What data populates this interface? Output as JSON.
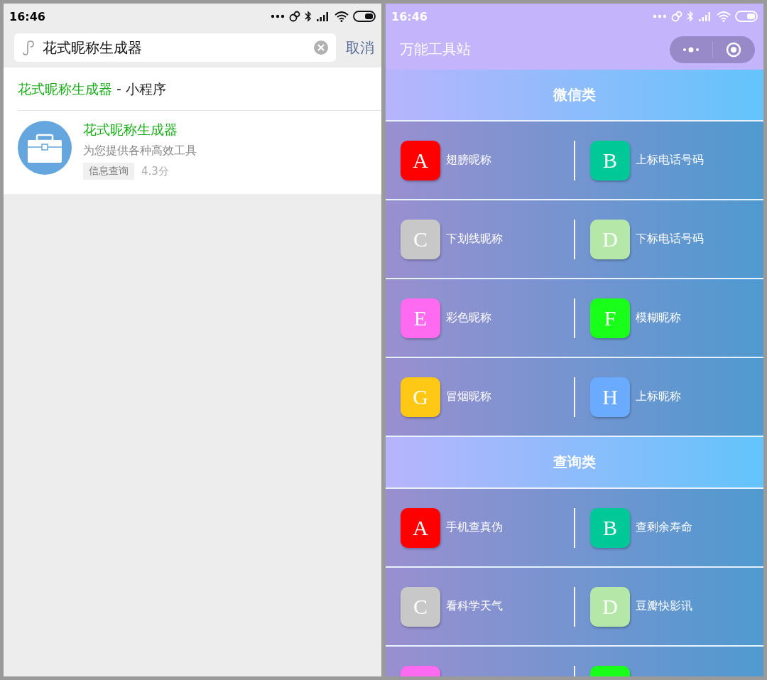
{
  "left_screen": {
    "status_bar": {
      "time": "16:46"
    },
    "search": {
      "value": "花式昵称生成器",
      "cancel": "取消"
    },
    "results": {
      "heading": {
        "match": "花式昵称生成器",
        "rest": " - 小程序"
      },
      "items": [
        {
          "name": "花式昵称生成器",
          "description": "为您提供各种高效工具",
          "tag": "信息查询",
          "rating": "4.3分"
        }
      ]
    }
  },
  "right_screen": {
    "status_bar": {
      "time": "16:46"
    },
    "nav_bar": {
      "title": "万能工具站"
    },
    "sections": [
      {
        "title": "微信类",
        "rows": [
          [
            {
              "letter": "A",
              "label": "翅膀昵称",
              "color": "#ff0000"
            },
            {
              "letter": "B",
              "label": "上标电话号码",
              "color": "#00c897"
            }
          ],
          [
            {
              "letter": "C",
              "label": "下划线昵称",
              "color": "#c8c8c8"
            },
            {
              "letter": "D",
              "label": "下标电话号码",
              "color": "#b5e8a8"
            }
          ],
          [
            {
              "letter": "E",
              "label": "彩色昵称",
              "color": "#ff6bf0"
            },
            {
              "letter": "F",
              "label": "模糊昵称",
              "color": "#19ff19"
            }
          ],
          [
            {
              "letter": "G",
              "label": "冒烟昵称",
              "color": "#ffc814"
            },
            {
              "letter": "H",
              "label": "上标昵称",
              "color": "#6aaaff"
            }
          ]
        ]
      },
      {
        "title": "查询类",
        "rows": [
          [
            {
              "letter": "A",
              "label": "手机查真伪",
              "color": "#ff0000"
            },
            {
              "letter": "B",
              "label": "查剩余寿命",
              "color": "#00c897"
            }
          ],
          [
            {
              "letter": "C",
              "label": "看科学天气",
              "color": "#c8c8c8"
            },
            {
              "letter": "D",
              "label": "豆瓣快影讯",
              "color": "#b5e8a8"
            }
          ],
          [
            {
              "color": "#ff6bf0"
            },
            {
              "color": "#19ff19"
            }
          ]
        ]
      }
    ]
  }
}
